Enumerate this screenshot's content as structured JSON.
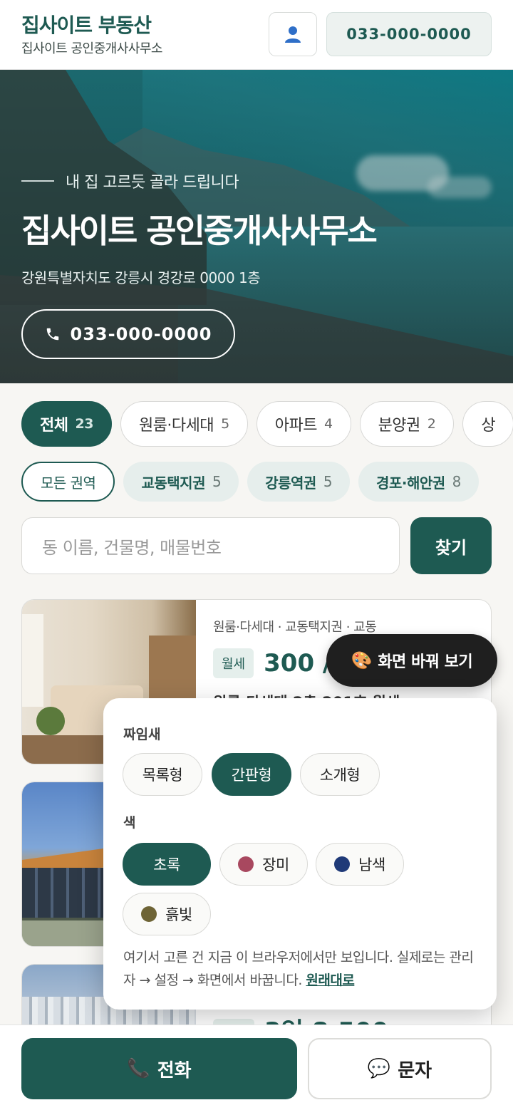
{
  "header": {
    "brand_title": "집사이트 부동산",
    "brand_sub": "집사이트 공인중개사사무소",
    "phone": "033-000-0000",
    "user_icon": "user-icon"
  },
  "hero": {
    "kicker": "내 집 고르듯 골라 드립니다",
    "title": "집사이트 공인중개사사무소",
    "address": "강원특별자치도 강릉시 경강로 0000 1층",
    "call_label": "033-000-0000"
  },
  "categories": [
    {
      "label": "전체",
      "count": "23"
    },
    {
      "label": "원룸·다세대",
      "count": "5"
    },
    {
      "label": "아파트",
      "count": "4"
    },
    {
      "label": "분양권",
      "count": "2"
    },
    {
      "label": "상",
      "count": ""
    }
  ],
  "areas": [
    {
      "label": "모든 권역",
      "count": ""
    },
    {
      "label": "교동택지권",
      "count": "5"
    },
    {
      "label": "강릉역권",
      "count": "5"
    },
    {
      "label": "경포·해안권",
      "count": "8"
    }
  ],
  "search": {
    "placeholder": "동 이름, 건물명, 매물번호",
    "button": "찾기"
  },
  "listings": [
    {
      "meta": "원룸·다세대 · 교동택지권 · 교동",
      "tag": "월세",
      "price": "300 /",
      "title": "원룸·다세대 2층 201호 월세"
    },
    {
      "meta": "",
      "tag": "",
      "price": "",
      "title": ""
    },
    {
      "meta": "",
      "tag": "",
      "price": "3억 8,500",
      "title": ""
    }
  ],
  "fab": {
    "label": "화면 바꿔 보기",
    "icon": "palette-icon"
  },
  "panel": {
    "layout_label": "짜임새",
    "layouts": [
      "목록형",
      "간판형",
      "소개형"
    ],
    "color_label": "색",
    "colors": [
      {
        "label": "초록",
        "color": "#1e5a52"
      },
      {
        "label": "장미",
        "color": "#a8485f"
      },
      {
        "label": "남색",
        "color": "#1f3a78"
      },
      {
        "label": "흙빛",
        "color": "#6e6436"
      }
    ],
    "note": "여기서 고른 건 지금 이 브라우저에서만 보입니다. 실제로는 관리자 → 설정 → 화면에서 바꿉니다.",
    "reset_link": "원래대로"
  },
  "bottom": {
    "call": "전화",
    "sms": "문자"
  }
}
